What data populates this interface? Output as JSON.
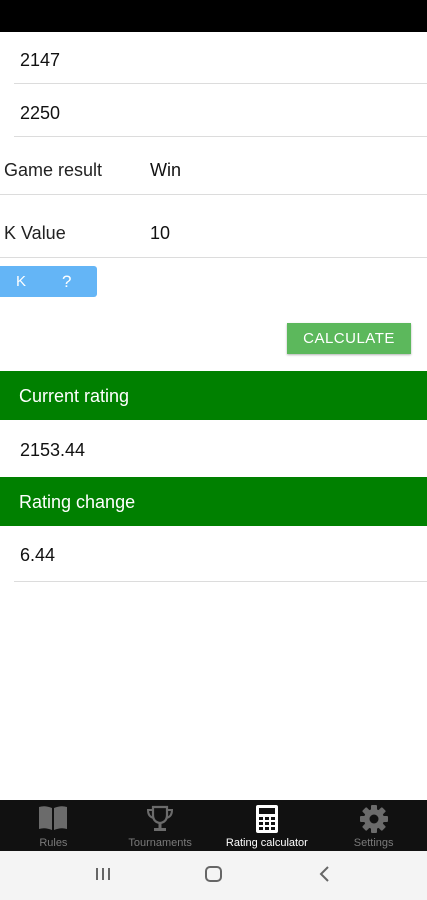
{
  "inputs": {
    "my_rating": "2147",
    "opponent_rating": "2250"
  },
  "rows": {
    "game_result_label": "Game result",
    "game_result_value": "Win",
    "k_value_label": "K Value",
    "k_value_value": "10"
  },
  "k_help": {
    "k": "K",
    "q": "?"
  },
  "calculate_label": "CALCULATE",
  "results": {
    "current_rating_header": "Current rating",
    "current_rating_value": "2153.44",
    "rating_change_header": "Rating change",
    "rating_change_value": "6.44"
  },
  "bottom_nav": [
    {
      "label": "Rules",
      "icon": "book-icon",
      "active": false
    },
    {
      "label": "Tournaments",
      "icon": "trophy-icon",
      "active": false
    },
    {
      "label": "Rating calculator",
      "icon": "calculator-icon",
      "active": true
    },
    {
      "label": "Settings",
      "icon": "gear-icon",
      "active": false
    }
  ],
  "colors": {
    "header_green": "#008000",
    "button_green": "#5cb85c",
    "k_blue": "#64b5f6"
  }
}
